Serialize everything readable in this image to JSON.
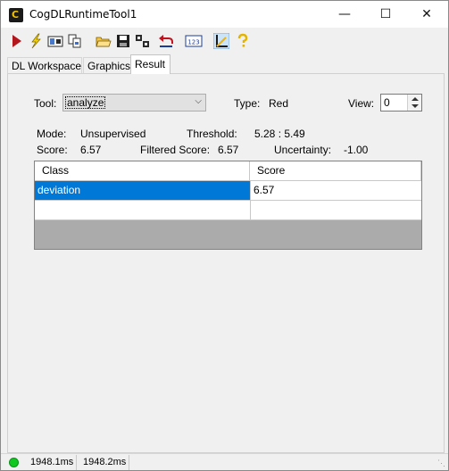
{
  "window": {
    "title": "CogDLRuntimeTool1",
    "app_icon_letter": "C",
    "minimize_glyph": "—",
    "maximize_glyph": "☐",
    "close_glyph": "✕"
  },
  "toolbar": {
    "icons": [
      "run-arrow-icon",
      "edit-bolt-icon",
      "image-view-icon",
      "copy-icon",
      "open-folder-icon",
      "save-icon",
      "export-icon",
      "undo-icon",
      "numeric-123-icon",
      "measure-icon",
      "help-icon"
    ],
    "numeric_label": "123"
  },
  "tabs": [
    {
      "label": "DL Workspace"
    },
    {
      "label": "Graphics"
    },
    {
      "label": "Result"
    }
  ],
  "result": {
    "tool_label": "Tool:",
    "tool_value": "analyze",
    "type_label": "Type:",
    "type_value": "Red",
    "view_label": "View:",
    "view_value": "0",
    "mode_label": "Mode:",
    "mode_value": "Unsupervised",
    "threshold_label": "Threshold:",
    "threshold_value": "5.28  :  5.49",
    "score_label": "Score:",
    "score_value": "6.57",
    "filtered_score_label": "Filtered Score:",
    "filtered_score_value": "6.57",
    "uncertainty_label": "Uncertainty:",
    "uncertainty_value": "-1.00"
  },
  "grid": {
    "columns": [
      "Class",
      "Score"
    ],
    "rows": [
      {
        "class": "deviation",
        "score": "6.57",
        "selected": true
      },
      {
        "class": "",
        "score": "",
        "selected": false
      }
    ]
  },
  "statusbar": {
    "status_color": "#11c821",
    "time1": "1948.1ms",
    "time2": "1948.2ms"
  },
  "colors": {
    "selection": "#0078d7",
    "grid_empty": "#ababab",
    "accent_red": "#c1121f"
  }
}
